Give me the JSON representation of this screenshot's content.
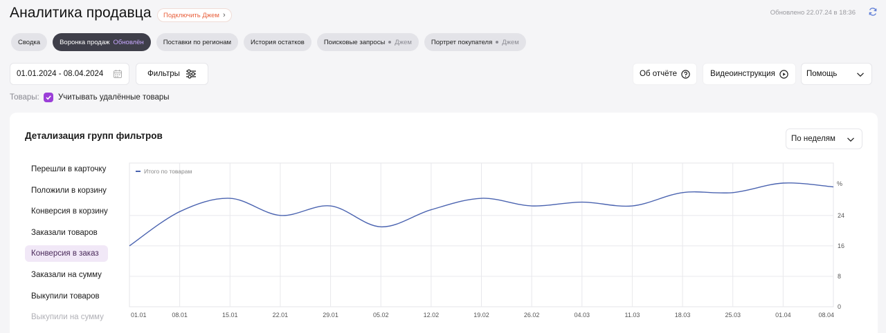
{
  "header": {
    "title": "Аналитика продавца",
    "connect_label": "Подключить Джем",
    "updated": "Обновлено 22.07.24 в 18:36"
  },
  "tabs": [
    {
      "label": "Сводка",
      "active": false,
      "badge": "",
      "gem": ""
    },
    {
      "label": "Воронка продаж",
      "active": true,
      "badge": "Обновлён",
      "gem": ""
    },
    {
      "label": "Поставки по регионам",
      "active": false,
      "badge": "",
      "gem": ""
    },
    {
      "label": "История остатков",
      "active": false,
      "badge": "",
      "gem": ""
    },
    {
      "label": "Поисковые запросы",
      "active": false,
      "badge": "",
      "gem": "Джем"
    },
    {
      "label": "Портрет покупателя",
      "active": false,
      "badge": "",
      "gem": "Джем"
    }
  ],
  "controls": {
    "date_range": "01.01.2024 - 08.04.2024",
    "filters_label": "Фильтры",
    "about_label": "Об отчёте",
    "video_label": "Видеоинструкция",
    "help_label": "Помощь"
  },
  "goods": {
    "label": "Товары:",
    "checkbox_label": "Учитывать удалённые товары",
    "checked": true
  },
  "card": {
    "title": "Детализация групп фильтров",
    "period_label": "По неделям",
    "metrics": [
      {
        "label": "Перешли в карточку",
        "active": false,
        "faded": false
      },
      {
        "label": "Положили в корзину",
        "active": false,
        "faded": false
      },
      {
        "label": "Конверсия в корзину",
        "active": false,
        "faded": false
      },
      {
        "label": "Заказали товаров",
        "active": false,
        "faded": false
      },
      {
        "label": "Конверсия в заказ",
        "active": true,
        "faded": false
      },
      {
        "label": "Заказали на сумму",
        "active": false,
        "faded": false
      },
      {
        "label": "Выкупили товаров",
        "active": false,
        "faded": false
      },
      {
        "label": "Выкупили на сумму",
        "active": false,
        "faded": true
      }
    ]
  },
  "colors": {
    "accent": "#9b3fd8",
    "line": "#4a63b0",
    "connect": "#e8603c"
  },
  "chart_data": {
    "type": "line",
    "x": [
      "01.01",
      "08.01",
      "15.01",
      "22.01",
      "29.01",
      "05.02",
      "12.02",
      "19.02",
      "26.02",
      "04.03",
      "11.03",
      "18.03",
      "25.03",
      "01.04",
      "08.04"
    ],
    "series": [
      {
        "name": "Итого по товарам",
        "values": [
          16,
          25,
          28.5,
          24,
          26.5,
          21,
          25.5,
          28.5,
          26.5,
          27.5,
          26.5,
          30,
          30,
          32.5,
          31.5
        ]
      }
    ],
    "yticks": [
      0,
      8,
      16,
      24
    ],
    "yunit": "%",
    "ylim": [
      0,
      32.5
    ],
    "grid": true,
    "legend": "top-left"
  }
}
